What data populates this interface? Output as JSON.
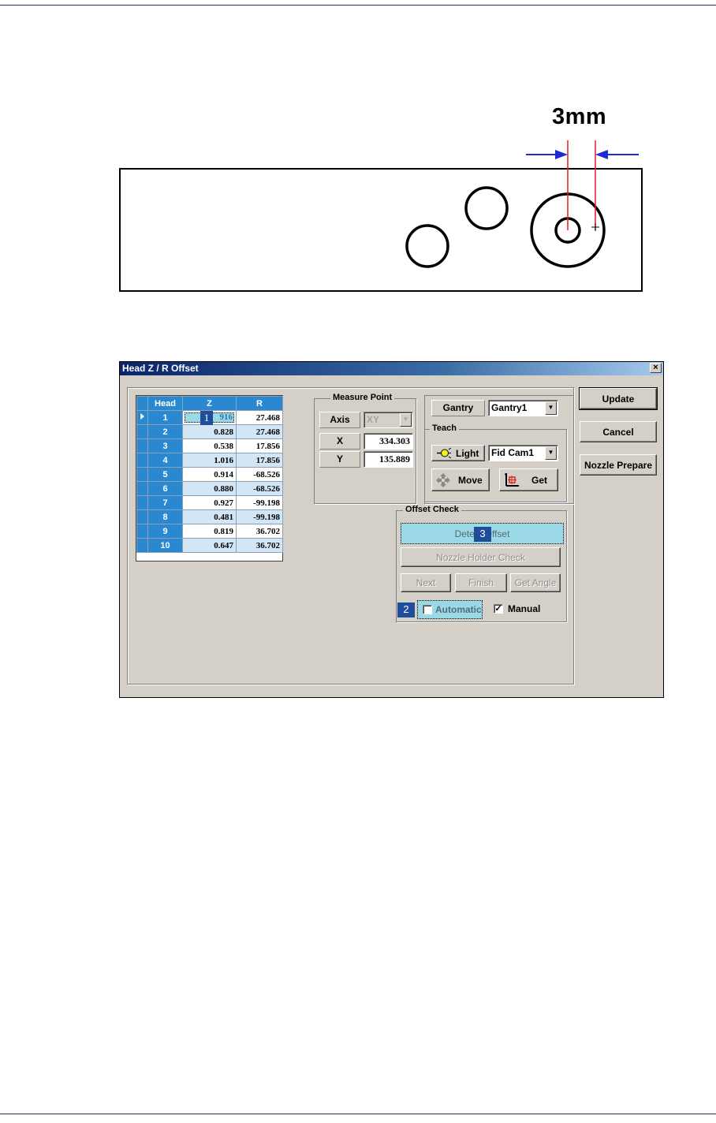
{
  "diagram": {
    "dimension_label": "3mm"
  },
  "dialog": {
    "title": "Head Z / R Offset",
    "close_glyph": "×",
    "grid": {
      "columns": [
        "Head",
        "Z",
        "R"
      ],
      "rows": [
        {
          "head": "1",
          "z": "916",
          "r": "27.468"
        },
        {
          "head": "2",
          "z": "0.828",
          "r": "27.468"
        },
        {
          "head": "3",
          "z": "0.538",
          "r": "17.856"
        },
        {
          "head": "4",
          "z": "1.016",
          "r": "17.856"
        },
        {
          "head": "5",
          "z": "0.914",
          "r": "-68.526"
        },
        {
          "head": "6",
          "z": "0.880",
          "r": "-68.526"
        },
        {
          "head": "7",
          "z": "0.927",
          "r": "-99.198"
        },
        {
          "head": "8",
          "z": "0.481",
          "r": "-99.198"
        },
        {
          "head": "9",
          "z": "0.819",
          "r": "36.702"
        },
        {
          "head": "10",
          "z": "0.647",
          "r": "36.702"
        }
      ]
    },
    "measure_point": {
      "title": "Measure Point",
      "axis_label": "Axis",
      "axis_value": "XY",
      "x_label": "X",
      "x_value": "334.303",
      "y_label": "Y",
      "y_value": "135.889"
    },
    "gantry": {
      "label": "Gantry",
      "value": "Gantry1"
    },
    "teach": {
      "title": "Teach",
      "light_label": "Light",
      "camera_value": "Fid Cam1",
      "move_label": "Move",
      "get_label": "Get"
    },
    "offset_check": {
      "title": "Offset Check",
      "detect_offset_label": "Detect Offset",
      "nozzle_holder_check_label": "Nozzle Holder Check",
      "next_label": "Next",
      "finish_label": "Finish",
      "get_angle_label": "Get Angle",
      "automatic_label": "Automatic",
      "manual_label": "Manual",
      "manual_checked": "✓"
    },
    "buttons": {
      "update": "Update",
      "cancel": "Cancel",
      "nozzle_prepare": "Nozzle Prepare"
    },
    "markers": {
      "m1": "1",
      "m2": "2",
      "m3": "3"
    }
  },
  "colors": {
    "title_bar": "#0a246a",
    "grid_header": "#2a88d0",
    "grid_alt_row": "#d2e6f6",
    "highlight": "#9cd9e6",
    "marker": "#1f4d9a",
    "rule": "#1f2f6b"
  }
}
